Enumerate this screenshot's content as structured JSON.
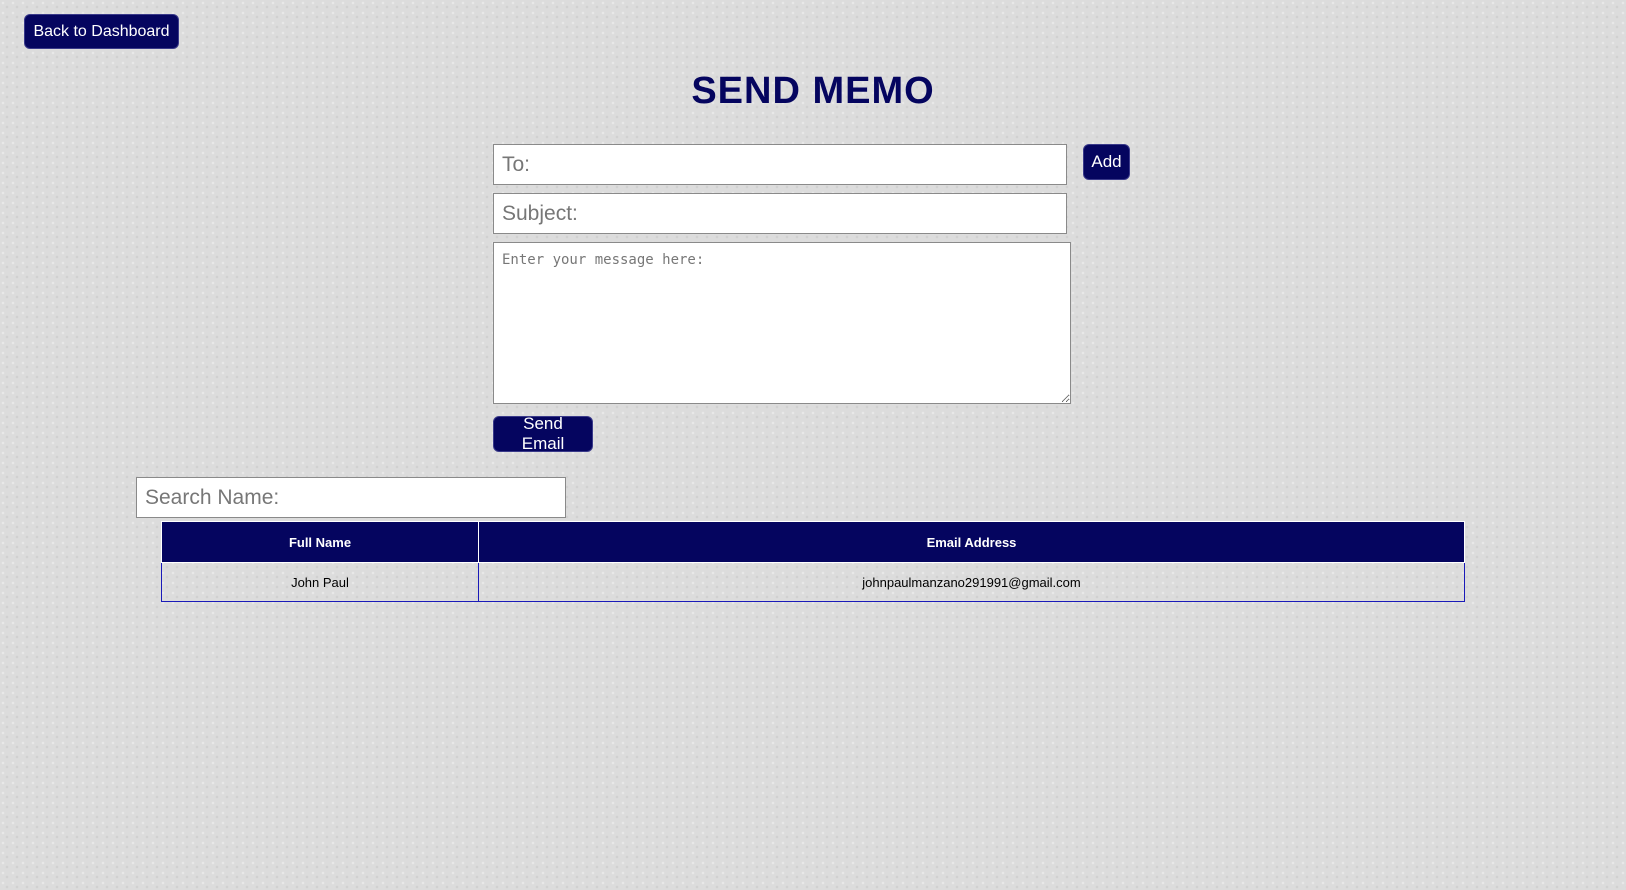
{
  "header": {
    "back_label": "Back to Dashboard",
    "title": "SEND MEMO"
  },
  "form": {
    "to_placeholder": "To:",
    "add_label": "Add",
    "subject_placeholder": "Subject:",
    "message_placeholder": "Enter your message here:",
    "send_label": "Send Email"
  },
  "search": {
    "placeholder": "Search Name:"
  },
  "table": {
    "headers": [
      "Full Name",
      "Email Address"
    ],
    "rows": [
      [
        "John Paul",
        "johnpaulmanzano291991@gmail.com"
      ]
    ]
  },
  "colors": {
    "accent": "#05055f",
    "row_border": "#1a1ab8",
    "background": "#dcdcdc"
  }
}
